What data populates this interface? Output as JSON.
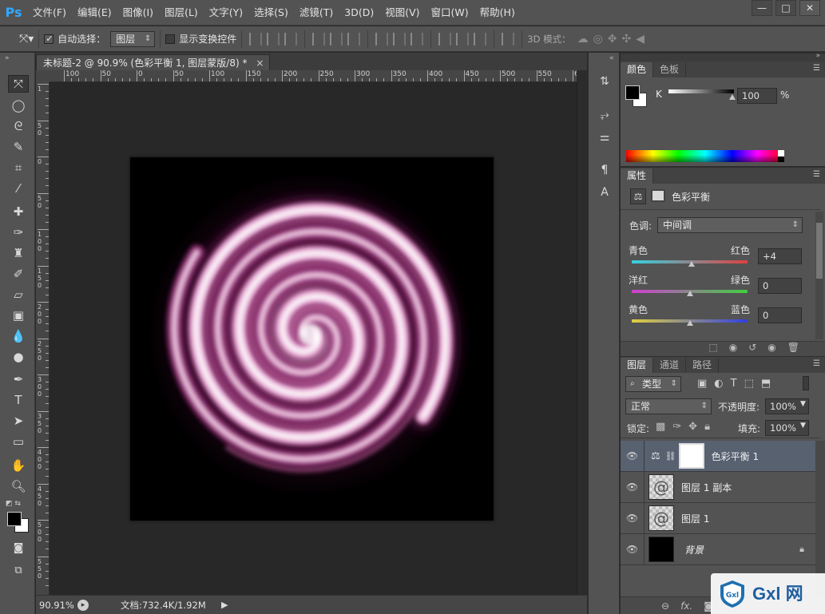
{
  "app": {
    "logo": "Ps"
  },
  "menu": [
    "文件(F)",
    "编辑(E)",
    "图像(I)",
    "图层(L)",
    "文字(Y)",
    "选择(S)",
    "滤镜(T)",
    "3D(D)",
    "视图(V)",
    "窗口(W)",
    "帮助(H)"
  ],
  "window_controls": {
    "minimize": "—",
    "restore": "□",
    "close": "✕"
  },
  "options": {
    "auto_select_label": "自动选择：",
    "auto_select_value": "图层",
    "show_transform_label": "显示变换控件",
    "mode_3d_label": "3D 模式："
  },
  "document": {
    "tab_title": "未标题-2 @ 90.9% (色彩平衡 1, 图层蒙版/8) *",
    "tab_close": "×",
    "ruler_h": [
      "100",
      "50",
      "0",
      "50",
      "100",
      "150",
      "200",
      "250",
      "300",
      "350",
      "400",
      "450",
      "500",
      "550",
      "6"
    ],
    "ruler_v": [
      "1",
      "5 0",
      "0",
      "5 0",
      "1 0 0",
      "1 5 0",
      "2 0 0",
      "2 5 0",
      "3 0 0",
      "3 5 0",
      "4 0 0",
      "4 5 0",
      "5 0 0",
      "5 5 0"
    ]
  },
  "status": {
    "zoom": "90.91%",
    "doc_size": "文档:732.4K/1.92M"
  },
  "color_panel": {
    "tabs": [
      "颜色",
      "色板"
    ],
    "channel": "K",
    "value": "100",
    "unit": "%"
  },
  "properties_panel": {
    "tab": "属性",
    "title": "色彩平衡",
    "tone_label": "色调:",
    "tone_value": "中间调",
    "sliders": [
      {
        "left": "青色",
        "right": "红色",
        "value": "+4",
        "level": 4
      },
      {
        "left": "洋红",
        "right": "绿色",
        "value": "0",
        "level": 0
      },
      {
        "left": "黄色",
        "right": "蓝色",
        "value": "0",
        "level": 0
      }
    ]
  },
  "layers_panel": {
    "tabs": [
      "图层",
      "通道",
      "路径"
    ],
    "filter_kind": "类型",
    "blend_mode": "正常",
    "opacity_label": "不透明度:",
    "opacity_value": "100%",
    "lock_label": "锁定:",
    "fill_label": "填充:",
    "fill_value": "100%",
    "layers": [
      {
        "name": "色彩平衡 1",
        "kind": "adjustment",
        "selected": true
      },
      {
        "name": "图层 1 副本",
        "kind": "pixel",
        "selected": false
      },
      {
        "name": "图层 1",
        "kind": "pixel",
        "selected": false
      },
      {
        "name": "背景",
        "kind": "background",
        "selected": false
      }
    ],
    "footer_icons": [
      "link-icon",
      "fx-icon",
      "mask-icon"
    ]
  },
  "watermark": {
    "brand": "Gxl 网"
  },
  "colors": {
    "swirl": "#b0307f",
    "selection": "#576170",
    "accent": "#31a8ff"
  }
}
